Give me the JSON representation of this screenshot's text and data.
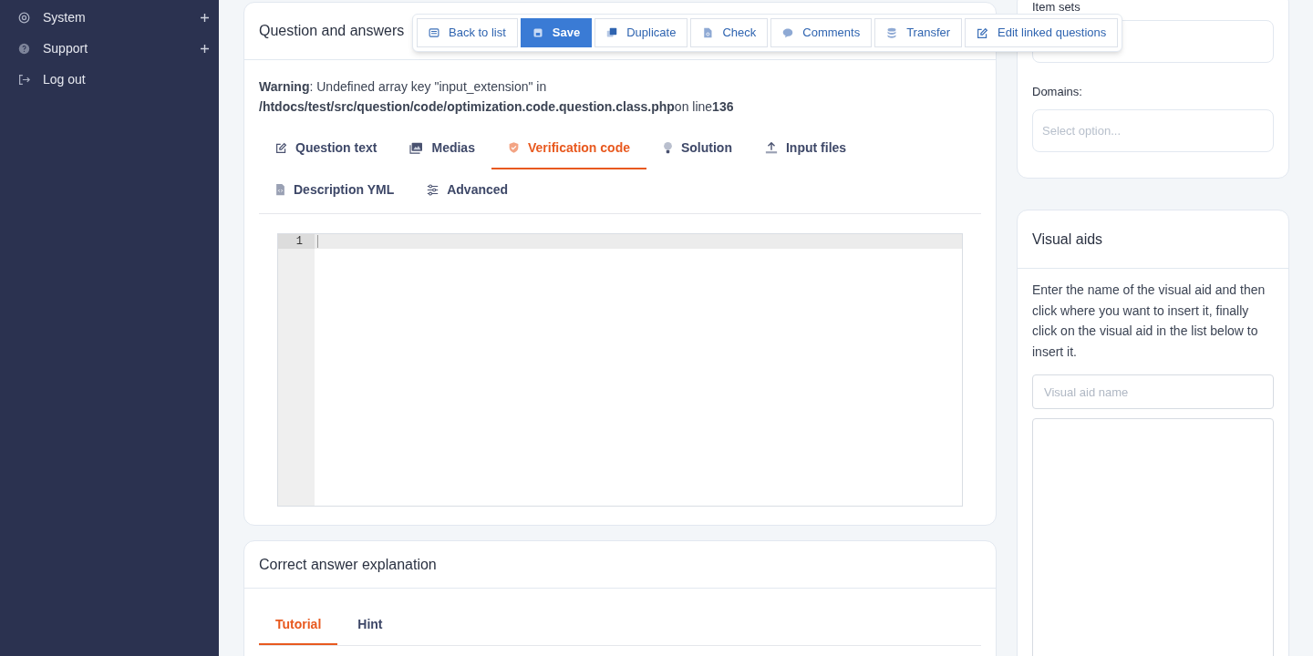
{
  "sidebar": {
    "items": [
      {
        "label": "System",
        "kind": "gear",
        "expandable": true
      },
      {
        "label": "Support",
        "kind": "help",
        "expandable": true
      },
      {
        "label": "Log out",
        "kind": "logout",
        "expandable": false
      }
    ]
  },
  "toolbar": {
    "buttons": [
      {
        "label": "Back to list",
        "kind": "list",
        "primary": false
      },
      {
        "label": "Save",
        "kind": "save",
        "primary": true
      },
      {
        "label": "Duplicate",
        "kind": "copy",
        "primary": false
      },
      {
        "label": "Check",
        "kind": "doc",
        "primary": false
      },
      {
        "label": "Comments",
        "kind": "chat",
        "primary": false
      },
      {
        "label": "Transfer",
        "kind": "db",
        "primary": false
      },
      {
        "label": "Edit linked questions",
        "kind": "edit",
        "primary": false
      }
    ]
  },
  "question_card": {
    "title": "Question and answers",
    "warning": "**Warning**: Undefined array key \"input_extension\" in **/htdocs/test/src/question/code/optimization.code.question.class.php**on line**136**",
    "tabs": [
      {
        "label": "Question text",
        "kind": "edit",
        "selected": false
      },
      {
        "label": "Medias",
        "kind": "image",
        "selected": false
      },
      {
        "label": "Verification code",
        "kind": "shield",
        "selected": true
      },
      {
        "label": "Solution",
        "kind": "bulb",
        "selected": false
      },
      {
        "label": "Input files",
        "kind": "upload",
        "selected": false
      },
      {
        "label": "Description YML",
        "kind": "file",
        "selected": false
      },
      {
        "label": "Advanced",
        "kind": "sliders",
        "selected": false
      }
    ],
    "editor": {
      "line_numbers": [
        "1"
      ]
    }
  },
  "explanation_card": {
    "title": "Correct answer explanation",
    "tabs": [
      {
        "label": "Tutorial",
        "selected": true
      },
      {
        "label": "Hint",
        "selected": false
      }
    ]
  },
  "meta_card": {
    "item_sets_label": "Item sets",
    "domains_label": "Domains:",
    "domains_placeholder": "Select option..."
  },
  "visual_aids": {
    "title": "Visual aids",
    "help": "Enter the name of the visual aid and then click where you want to insert it, finally click on the visual aid in the list below to insert it.",
    "name_placeholder": "Visual aid name"
  }
}
